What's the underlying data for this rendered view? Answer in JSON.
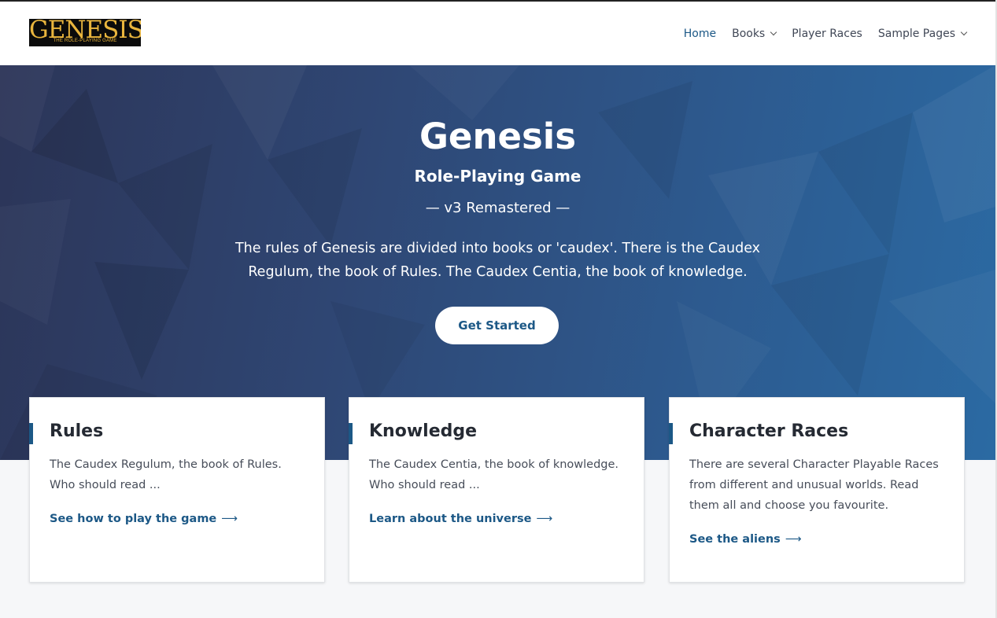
{
  "logo": {
    "main": "GENESIS",
    "sub": "THE ROLE-PLAYING GAME"
  },
  "nav": [
    {
      "label": "Home",
      "active": true,
      "has_dropdown": false
    },
    {
      "label": "Books",
      "active": false,
      "has_dropdown": true
    },
    {
      "label": "Player Races",
      "active": false,
      "has_dropdown": false
    },
    {
      "label": "Sample Pages",
      "active": false,
      "has_dropdown": true
    }
  ],
  "hero": {
    "title": "Genesis",
    "subtitle": "Role-Playing Game",
    "version": "— v3 Remastered —",
    "description": "The rules of Genesis are divided into books or 'caudex'. There is the Caudex Regulum, the book of Rules. The Caudex Centia, the book of knowledge.",
    "cta_label": "Get Started"
  },
  "cards": [
    {
      "title": "Rules",
      "text": "The Caudex Regulum, the book of Rules. Who should read ...",
      "link": "See how to play the game",
      "arrow": "⟶"
    },
    {
      "title": "Knowledge",
      "text": "The Caudex Centia, the book of knowledge. Who should read ...",
      "link": "Learn about the universe",
      "arrow": "⟶"
    },
    {
      "title": "Character Races",
      "text": "There are several Character Playable Races from different and unusual worlds. Read them all and choose you favourite.",
      "link": "See the aliens",
      "arrow": "⟶"
    }
  ],
  "colors": {
    "accent": "#1c5886",
    "hero_start": "#2c3558",
    "hero_end": "#2b6aa3",
    "logo_gold": "#e9b53d"
  }
}
